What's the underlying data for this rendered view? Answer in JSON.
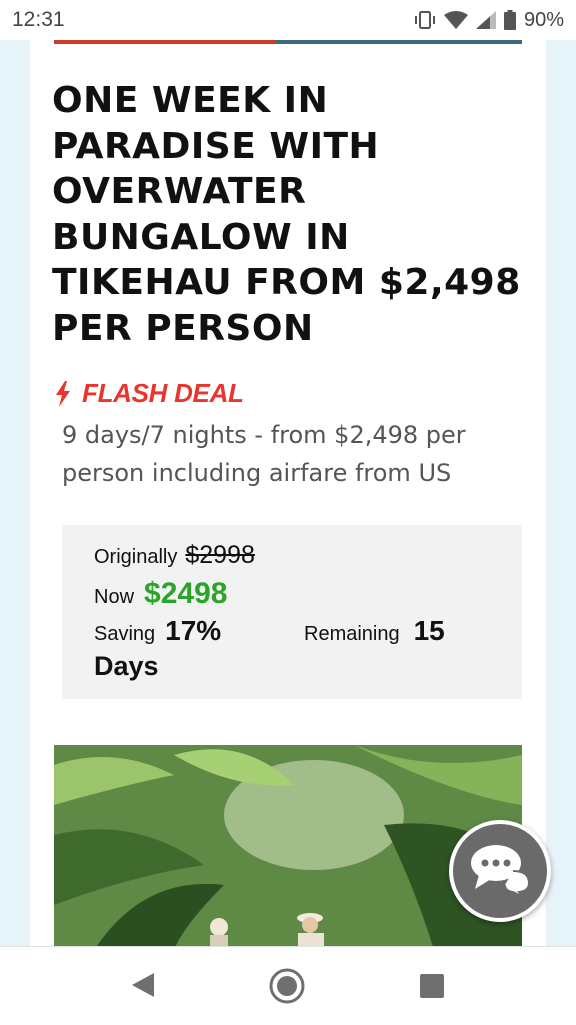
{
  "status_bar": {
    "time": "12:31",
    "battery_percent": "90%"
  },
  "article": {
    "headline": "ONE WEEK IN PARADISE WITH OVERWATER BUNGALOW IN TIKEHAU FROM $2,498 PER PERSON",
    "flash_label": "FLASH DEAL",
    "subtitle": "9 days/7 nights - from $2,498 per person including airfare from US"
  },
  "pricing": {
    "originally_label": "Originally",
    "originally_value": "$2998",
    "now_label": "Now",
    "now_value": "$2498",
    "saving_label": "Saving",
    "saving_value": "17%",
    "remaining_label": "Remaining",
    "remaining_value": "15",
    "days_label": "Days"
  },
  "colors": {
    "flash": "#e8352d",
    "now_price": "#2aa52a",
    "page_bg": "#e6f3f8"
  },
  "icons": {
    "flash": "lightning-bolt",
    "chat": "chat-bubbles",
    "nav": [
      "back-triangle",
      "home-circle",
      "recents-square"
    ]
  }
}
